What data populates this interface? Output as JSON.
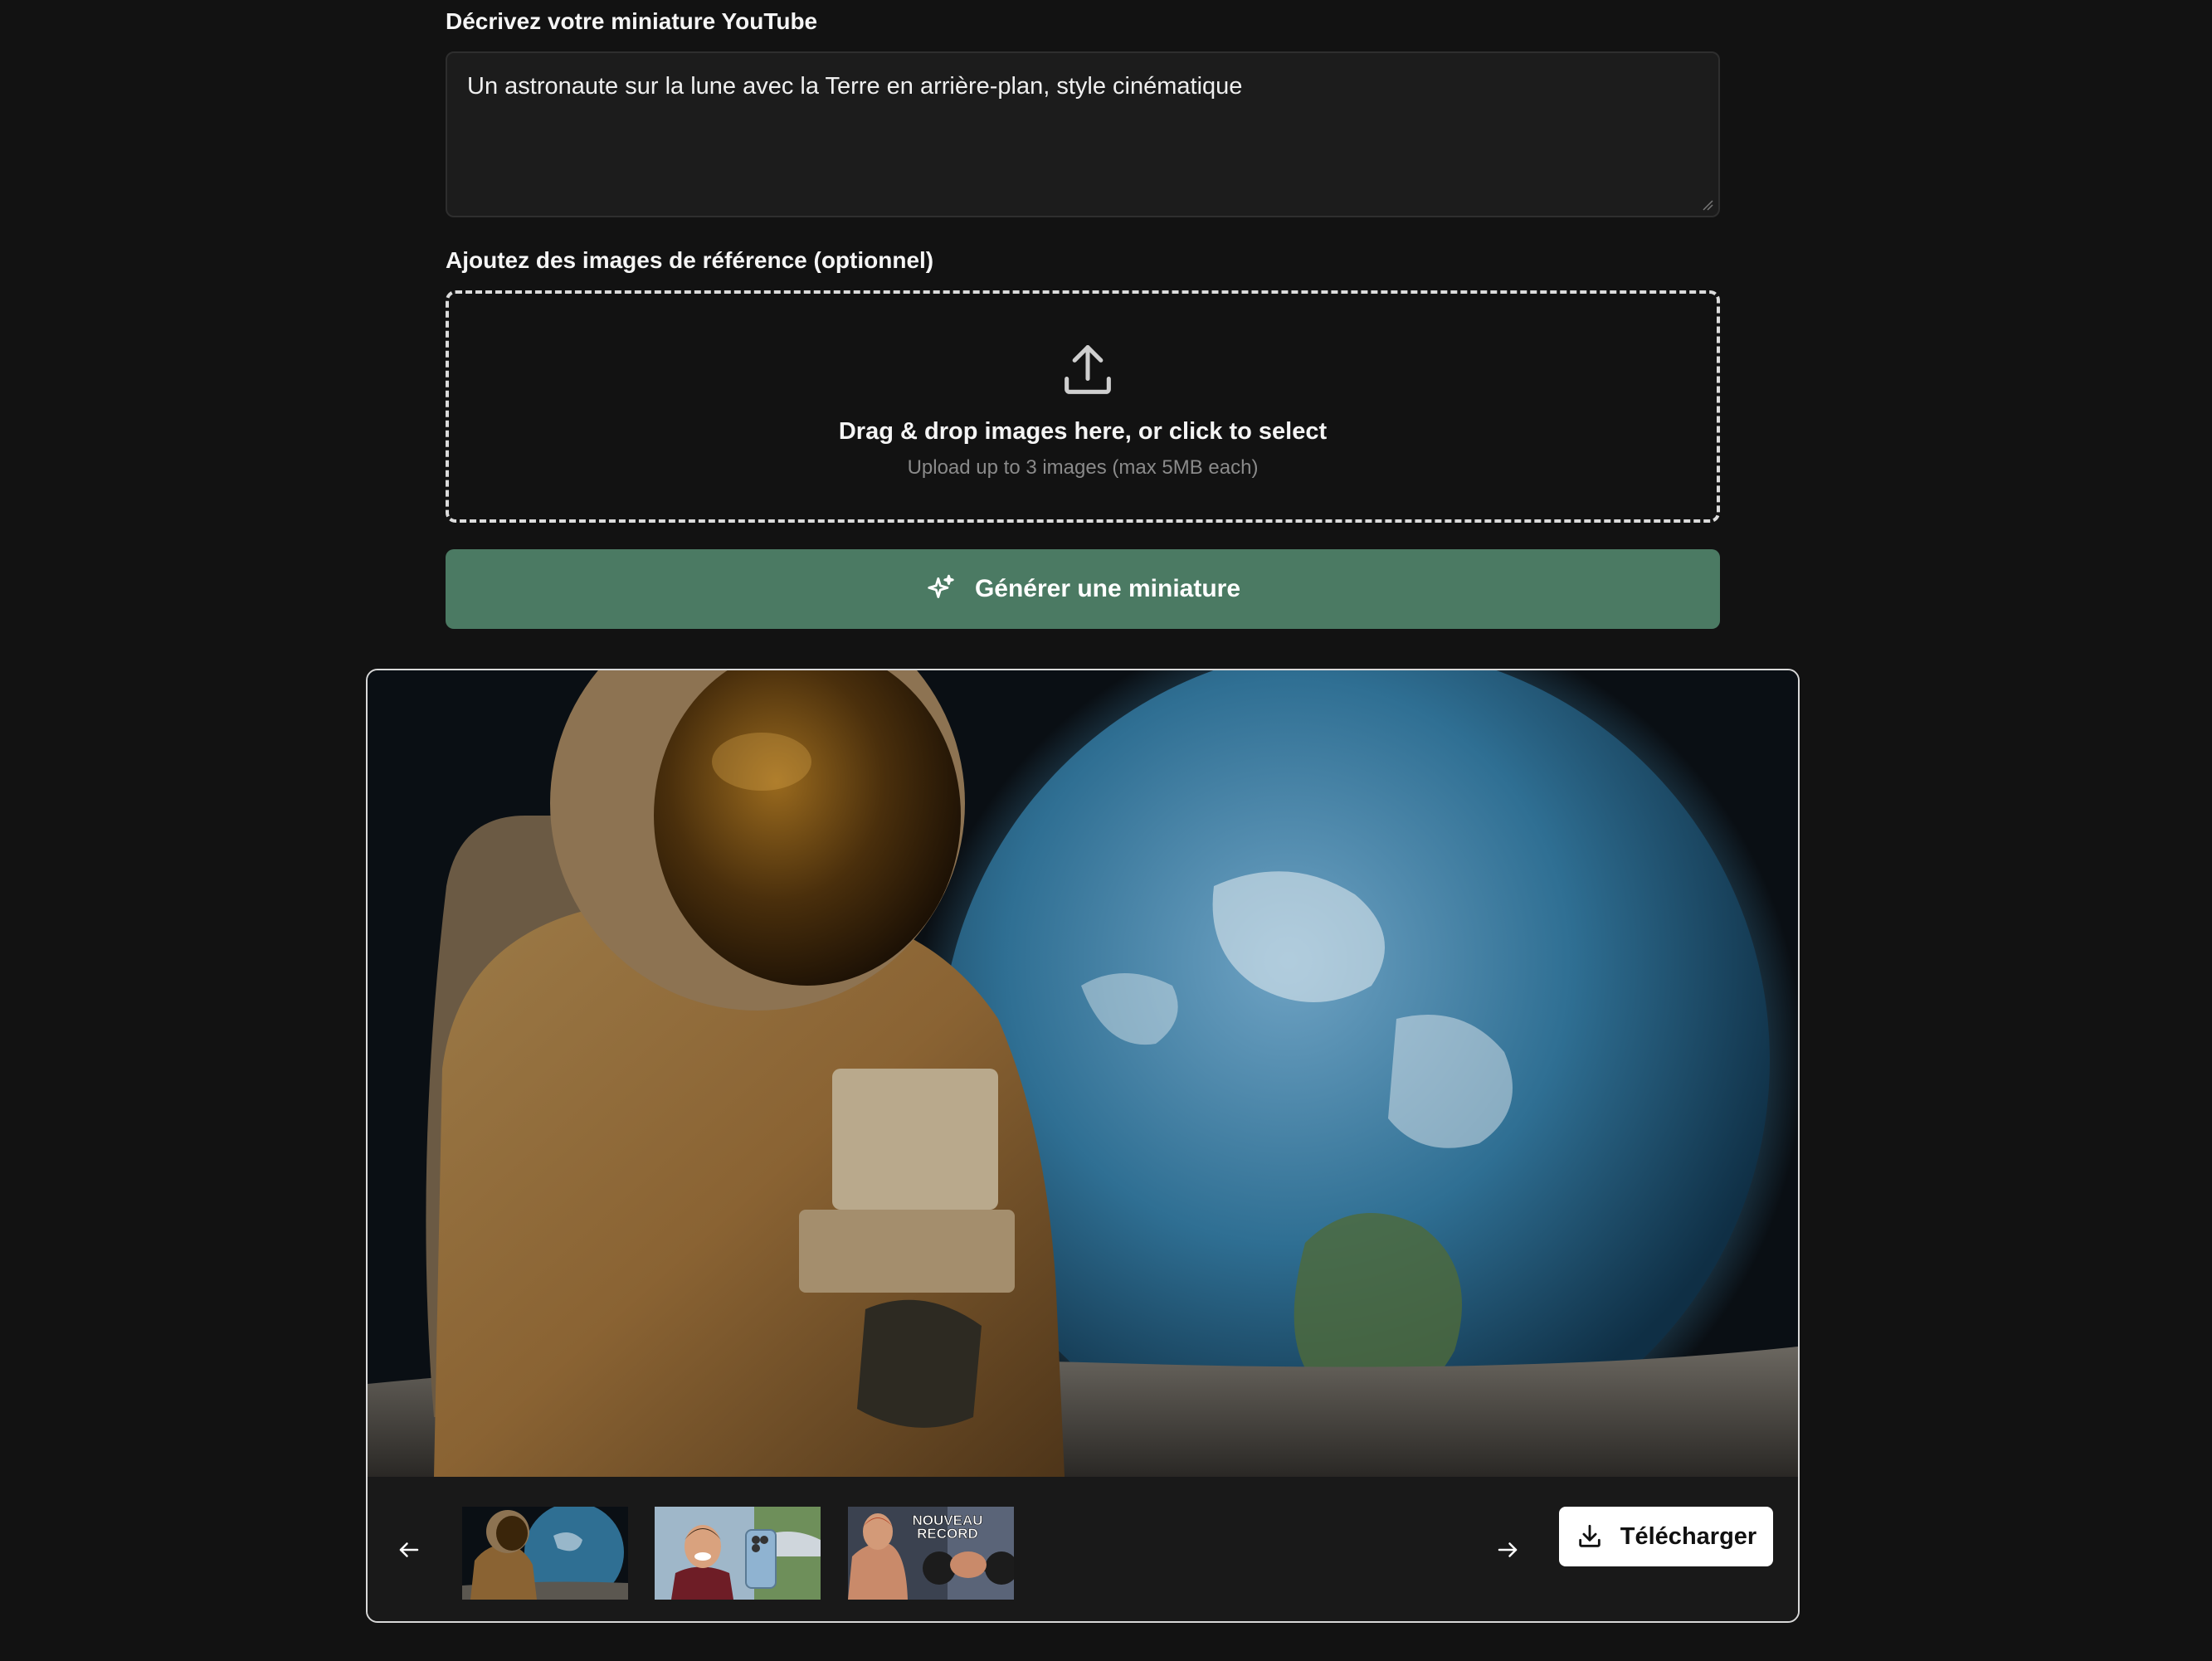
{
  "form": {
    "description_label": "Décrivez votre miniature YouTube",
    "description_value": "Un astronaute sur la lune avec la Terre en arrière-plan, style cinématique",
    "reference_label": "Ajoutez des images de référence (optionnel)",
    "dropzone_title": "Drag & drop images here, or click to select",
    "dropzone_subtitle": "Upload up to 3 images (max 5MB each)",
    "generate_label": "Générer une miniature"
  },
  "result": {
    "download_label": "Télécharger",
    "thumbnails": [
      {
        "name": "astronaut-earth"
      },
      {
        "name": "man-with-phone"
      },
      {
        "name": "gym-record",
        "text_line1": "NOUVEAU",
        "text_line2": "RECORD"
      }
    ]
  },
  "icons": {
    "upload": "upload-icon",
    "sparkle": "sparkle-icon",
    "prev": "arrow-left-icon",
    "next": "arrow-right-icon",
    "download": "download-icon"
  },
  "colors": {
    "background": "#121212",
    "accent": "#4b7a63",
    "card_border": "#d8d8d8"
  }
}
